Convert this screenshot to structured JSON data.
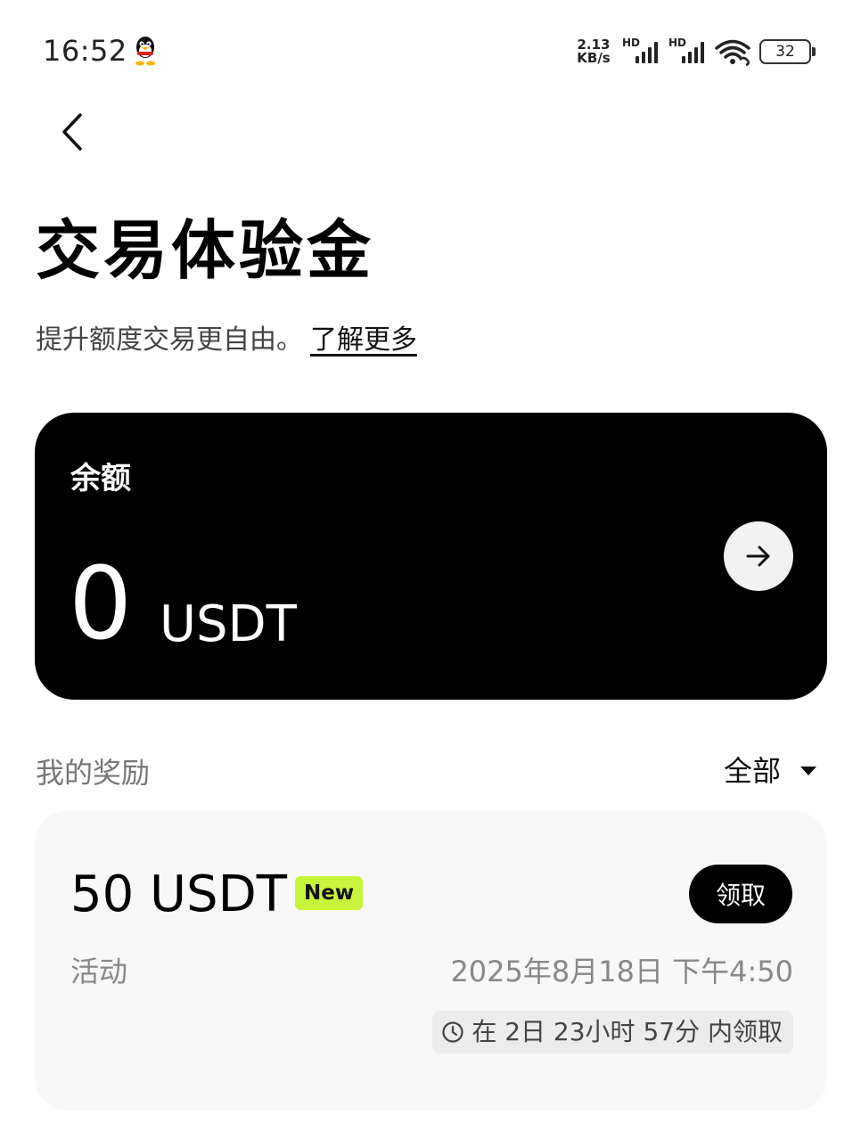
{
  "status_bar": {
    "time": "16:52",
    "net_speed_value": "2.13",
    "net_speed_unit": "KB/s",
    "signal_1_label": "HD",
    "signal_2_label": "HD",
    "battery": "32",
    "icons": [
      "qq-icon",
      "signal-icon",
      "signal-icon",
      "wifi-icon",
      "battery-icon"
    ]
  },
  "header": {
    "back_icon": "chevron-left-icon",
    "title": "交易体验金",
    "subtitle": "提升额度交易更自由。",
    "learn_more": "了解更多"
  },
  "balance_card": {
    "label": "余额",
    "amount": "0",
    "unit": "USDT",
    "arrow_icon": "arrow-right-icon"
  },
  "rewards": {
    "section_label": "我的奖励",
    "filter_label": "全部",
    "filter_icon": "caret-down-icon",
    "items": [
      {
        "amount": "50 USDT",
        "badge": "New",
        "claim_label": "领取",
        "source": "活动",
        "date": "2025年8月18日 下午4:50",
        "countdown": "在 2日 23小时 57分 内领取",
        "countdown_icon": "clock-icon"
      }
    ]
  },
  "colors": {
    "card_bg": "#000000",
    "badge_bg": "#c8f53c",
    "reward_card_bg": "#f8f8f8",
    "muted_text": "#888888"
  }
}
